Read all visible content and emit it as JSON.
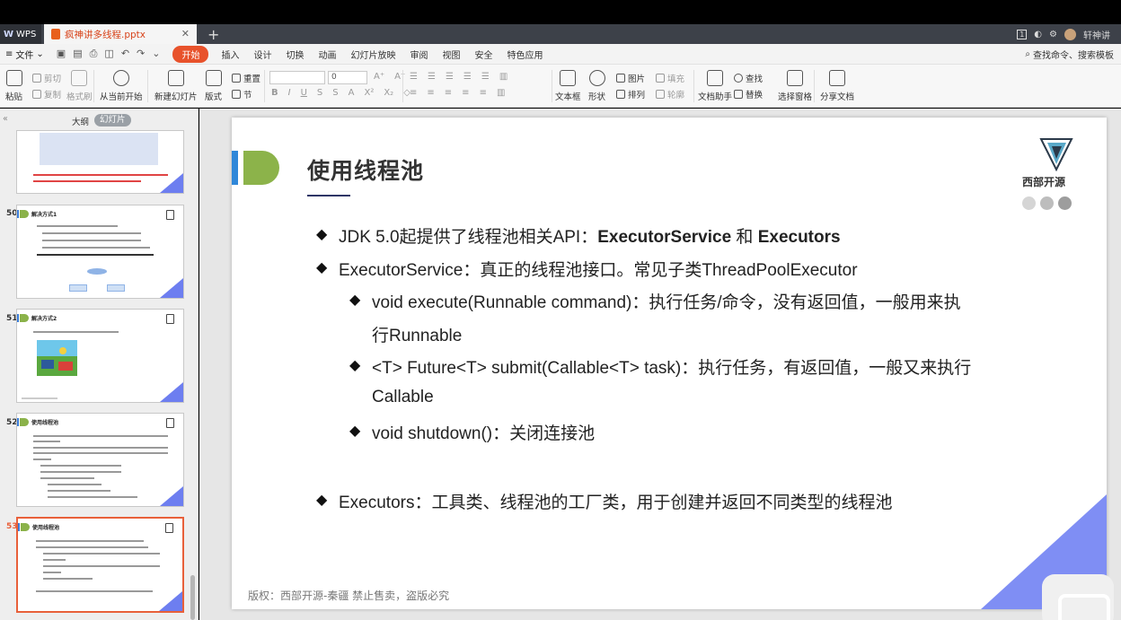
{
  "tabbar": {
    "app": "WPS",
    "doc_tab": "疯神讲多线程.pptx",
    "new_tab": "+",
    "user": "轩神讲"
  },
  "menubar": {
    "file": "文件",
    "start": "开始",
    "items": [
      "插入",
      "设计",
      "切换",
      "动画",
      "幻灯片放映",
      "审阅",
      "视图",
      "安全",
      "特色应用"
    ],
    "search": "查找命令、搜索模板"
  },
  "ribbon": {
    "paste": "粘贴",
    "cut": "剪切",
    "copy": "复制",
    "format_painter": "格式刷",
    "play_from_current": "从当前开始",
    "new_slide": "新建幻灯片",
    "layout": "版式",
    "reset": "重置",
    "section": "节",
    "font_size": "0",
    "textbox": "文本框",
    "shape": "形状",
    "picture": "图片",
    "arrange": "排列",
    "fill": "填充",
    "outline": "轮廓",
    "doc_assistant": "文档助手",
    "find": "查找",
    "replace": "替换",
    "selection_pane": "选择窗格",
    "share_doc": "分享文档"
  },
  "leftpanel": {
    "tab_outline": "大纲",
    "tab_slides": "幻灯片",
    "thumbnails": [
      {
        "num": "",
        "title": ""
      },
      {
        "num": "50",
        "title": "解决方式1"
      },
      {
        "num": "51",
        "title": "解决方式2"
      },
      {
        "num": "52",
        "title": "使用线程池"
      },
      {
        "num": "53",
        "title": "使用线程池"
      }
    ]
  },
  "slide": {
    "title": "使用线程池",
    "logo_text": "西部开源",
    "bullets": {
      "b1_pre": "JDK 5.0起提供了线程池相关API：",
      "b1_bold1": "ExecutorService",
      "b1_mid": " 和 ",
      "b1_bold2": "Executors",
      "b2": "ExecutorService：真正的线程池接口。常见子类ThreadPoolExecutor",
      "b3_line1": "void execute(Runnable command)：执行任务/命令，没有返回值，一般用来执",
      "b3_line2": "行Runnable",
      "b4_line1": "<T> Future<T> submit(Callable<T> task)：执行任务，有返回值，一般又来执行",
      "b4_line2": "Callable",
      "b5": "void shutdown()：关闭连接池",
      "b6": "Executors：工具类、线程池的工厂类，用于创建并返回不同类型的线程池"
    },
    "footer": "版权：西部开源-秦疆    禁止售卖，盗版必究"
  },
  "colors": {
    "accent_orange": "#e8522b",
    "bar_blue": "#2f87d9",
    "tab_green": "#8cb34a",
    "triangle_purple": "#7f8ef4"
  }
}
